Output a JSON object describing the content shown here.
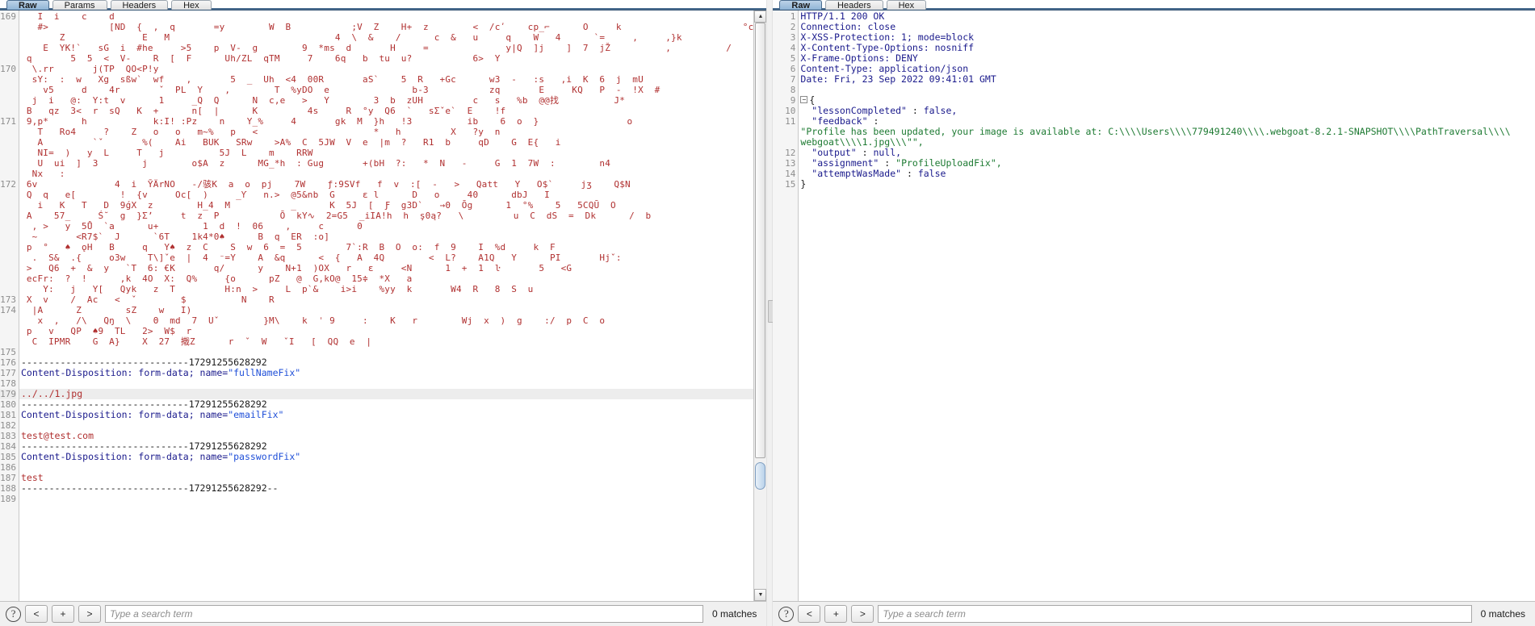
{
  "app": {
    "title": "Burp Suite — HTTP Request / Response viewer"
  },
  "left_panel": {
    "tabs": [
      {
        "label": "Raw",
        "active": true
      },
      {
        "label": "Params",
        "active": false
      },
      {
        "label": "Headers",
        "active": false
      },
      {
        "label": "Hex",
        "active": false
      }
    ],
    "first_line_number": 169,
    "last_line_number": 189,
    "highlighted_line": 179,
    "lines": [
      {
        "n": 169,
        "type": "bin",
        "text": "   I  i    c    d"
      },
      {
        "n": "",
        "type": "bin",
        "text": "   #>           [ND  {  ,  q       =y        W  B           ;V  Z    H+  z        <  /cʹ    cp_⌐      O     k                      °c"
      },
      {
        "n": "",
        "type": "bin",
        "text": "       Z              E   M                              4  \\  &    /      c  &   u     q    W   4      `=     ,     ,}k"
      },
      {
        "n": "",
        "type": "bin",
        "text": "    E  YK!`   sG  i  #he     >5    p  V-  g        9  *ms  d       H     =              y|Q  ]j    ]  7  jŽ          ,          /"
      },
      {
        "n": "",
        "type": "bin",
        "text": " q       5  5  <  V-    R  [  F      Uh/ZL  qTM     7    6q   b  tu  u?           6>  Y"
      },
      {
        "n": 170,
        "type": "bin",
        "text": "  \\.rr       j(TP  QO<P!y"
      },
      {
        "n": "",
        "type": "bin",
        "text": "  sY:  :  w   Xg  sßw`  wf    ,       5  _  Uh  <4  00R       aS`    5  R   +Gc      w3  -   :s   ,i  K  6  j  mU"
      },
      {
        "n": "",
        "type": "bin",
        "text": "    v5     d    4r       ˇ  PL  Y    ,        T  %yDO  e               b-3           zq       E     KQ   P  -  !X  #"
      },
      {
        "n": "",
        "type": "bin",
        "text": "  j  i   @:  Y:t  v      1     _Q  Q      N  c,e   >   Y        3  b  zUH         c   s   %b  @@找          J*"
      },
      {
        "n": "",
        "type": "bin",
        "text": " B   qz  3<  r  sQ   K  +      n[  |      K         4s     R  °y  Q6  `   sΣˇe`  E    !f"
      },
      {
        "n": 171,
        "type": "bin",
        "text": " 9,p*      h            k:I! :Pz    n    Y_%     4       gk  M  }h   !3          ib    6  o  }                o"
      },
      {
        "n": "",
        "type": "bin",
        "text": "   T   Ro4     ?    Z   o   o   m~%   p   <                     *   h         X   ?y  n"
      },
      {
        "n": "",
        "type": "bin",
        "text": "   A         `ˇ       %(    Ai   BUK   SRw    >A%  C  5JW  V  e  |m  ?   R1  b     qD    G  E{   i"
      },
      {
        "n": "",
        "type": "bin",
        "text": "   NI=  )   y  L     T   j          5J  L    m    RRW"
      },
      {
        "n": "",
        "type": "bin",
        "text": "   U  ui  ]  3        j        o$A  z      MG_*h  : Gug       +(bH  ?:   *  N   -     G  1  7W  :        n4"
      },
      {
        "n": "",
        "type": "bin",
        "text": "  Nx   :"
      },
      {
        "n": 172,
        "type": "bin",
        "text": " 6v              4  i  ȲÄrNO   -/骇K  a  o  pj    7W    ƒ:9SVf   f  v  :[  -   >   Qatt   Y   O$`     jʒ    Q$N"
      },
      {
        "n": "",
        "type": "bin",
        "text": " Q  q   e[        !  {v     Oc[  )     _Ƴ   n.>  @5&nb  G     ε l      D   o     40      dbJ   I"
      },
      {
        "n": "",
        "type": "bin",
        "text": "   i   K   T   D  9ǵX  z        H_4  M           _      K  5J  [  Ƒ  g3D`   →0  Ōg      1  °%    5   5CQŪ  O"
      },
      {
        "n": "",
        "type": "bin",
        "text": " A    57_     Ś˘  g  }Σʼ     t  z  P           Ō  kY∿  2=G5  _iIA!h  h  ş0ą?   \\         u  C  dS  =  Dk      /  b"
      },
      {
        "n": "",
        "type": "bin",
        "text": "  , >   y  5Ů  `a      u+        1  d  !  06    ,     c      0"
      },
      {
        "n": "",
        "type": "bin",
        "text": "  ~       <R7$`  J      `6T    1k4*0♠      B  q  ER  :o]"
      },
      {
        "n": "",
        "type": "bin",
        "text": " p  °   ♠  ǫH   B     q   Y♠  z  C    S  w  6  =  5        7`:R  B  O  o:  f  9    I  %d     k  F"
      },
      {
        "n": "",
        "type": "bin",
        "text": "  .  S&  .{     o3w    T\\]ˇe  |  4  ⁻=Y    A  &q      <  {   A  4Q        <  L?    A1Q   Y      PI       Hjˇ:"
      },
      {
        "n": "",
        "type": "bin",
        "text": " >   Q6  +  &  y   `T  6: €K       q/      y    N+1  )OX   r   ε     <N      1  +  1  ŀ       5   <G"
      },
      {
        "n": "",
        "type": "bin",
        "text": " ecFr:  ?  !      ,k  4O  X:  Q%     {o      pZ   @  G,kO@  15≑  *X   a"
      },
      {
        "n": "",
        "type": "bin",
        "text": "    Y:   j   Y[   Qyk   z  T         H:n  >     L  p`&    i>i    %yy  k       W4  R   8  S  u"
      },
      {
        "n": 173,
        "type": "bin",
        "text": " X  v    /  Ac   <  ˇ        $          N    R"
      },
      {
        "n": 174,
        "type": "bin",
        "text": "  |A      Z        sZ    w   I)"
      },
      {
        "n": "",
        "type": "bin",
        "text": "   x  ,   /\\   Qŋ  \\    Θ  md  7  Uˇ        }M\\    k  ˈ 9     :    K   r        Wj  x  )  g    :/  p  C  o"
      },
      {
        "n": "",
        "type": "bin",
        "text": " p   v   QP  ♠9  TL   2>  W$  r"
      },
      {
        "n": "",
        "type": "bin",
        "text": "  C  IPMR    G  A}    X  27  撠Z      r  ˇ  W   ˇI   [  QQ  e  |"
      },
      {
        "n": 175,
        "type": "bin",
        "text": ""
      },
      {
        "n": 176,
        "type": "boundary",
        "text": "------------------------------17291255628292"
      },
      {
        "n": 177,
        "type": "disposition",
        "prefix": "Content-Disposition: form-data; name=",
        "name": "\"fullNameFix\""
      },
      {
        "n": 178,
        "type": "blank",
        "text": ""
      },
      {
        "n": 179,
        "type": "value",
        "text": "../../1.jpg",
        "highlighted": true
      },
      {
        "n": 180,
        "type": "boundary",
        "text": "------------------------------17291255628292"
      },
      {
        "n": 181,
        "type": "disposition",
        "prefix": "Content-Disposition: form-data; name=",
        "name": "\"emailFix\""
      },
      {
        "n": 182,
        "type": "blank",
        "text": ""
      },
      {
        "n": 183,
        "type": "value",
        "text": "test@test.com"
      },
      {
        "n": 184,
        "type": "boundary",
        "text": "------------------------------17291255628292"
      },
      {
        "n": 185,
        "type": "disposition",
        "prefix": "Content-Disposition: form-data; name=",
        "name": "\"passwordFix\""
      },
      {
        "n": 186,
        "type": "blank",
        "text": ""
      },
      {
        "n": 187,
        "type": "value",
        "text": "test"
      },
      {
        "n": 188,
        "type": "boundary",
        "text": "------------------------------17291255628292--"
      },
      {
        "n": 189,
        "type": "blank",
        "text": ""
      }
    ],
    "search": {
      "help_label": "?",
      "prev_label": "<",
      "add_label": "+",
      "next_label": ">",
      "placeholder": "Type a search term",
      "value": "",
      "matches": "0 matches"
    }
  },
  "right_panel": {
    "tabs": [
      {
        "label": "Raw",
        "active": true
      },
      {
        "label": "Headers",
        "active": false
      },
      {
        "label": "Hex",
        "active": false
      }
    ],
    "lines": [
      {
        "n": 1,
        "type": "status",
        "text": "HTTP/1.1 200 OK"
      },
      {
        "n": 2,
        "type": "header",
        "key": "Connection",
        "value": "close"
      },
      {
        "n": 3,
        "type": "header",
        "key": "X-XSS-Protection",
        "value": "1; mode=block"
      },
      {
        "n": 4,
        "type": "header",
        "key": "X-Content-Type-Options",
        "value": "nosniff"
      },
      {
        "n": 5,
        "type": "header",
        "key": "X-Frame-Options",
        "value": "DENY"
      },
      {
        "n": 6,
        "type": "header",
        "key": "Content-Type",
        "value": "application/json"
      },
      {
        "n": 7,
        "type": "header",
        "key": "Date",
        "value": "Fri, 23 Sep 2022 09:41:01 GMT"
      },
      {
        "n": 8,
        "type": "blank",
        "text": ""
      },
      {
        "n": 9,
        "type": "brace-open",
        "fold": "−",
        "text": "{"
      },
      {
        "n": 10,
        "type": "json-pair",
        "key": "\"lessonCompleted\"",
        "sep": " : ",
        "lit": "false,"
      },
      {
        "n": 11,
        "type": "json-key-only",
        "key": "\"feedback\"",
        "sep": " :"
      },
      {
        "n": "",
        "type": "json-str-wrap",
        "text": "\"Profile has been updated, your image is available at: C:\\\\\\\\Users\\\\\\\\779491240\\\\\\\\.webgoat-8.2.1-SNAPSHOT\\\\\\\\PathTraversal\\\\\\\\"
      },
      {
        "n": "",
        "type": "json-str-wrap",
        "text": "webgoat\\\\\\\\1.jpg\\\\\\\"\","
      },
      {
        "n": 12,
        "type": "json-pair",
        "key": "\"output\"",
        "sep": " : ",
        "lit": "null,"
      },
      {
        "n": 13,
        "type": "json-pair-str",
        "key": "\"assignment\"",
        "sep": " : ",
        "str": "\"ProfileUploadFix\","
      },
      {
        "n": 14,
        "type": "json-pair",
        "key": "\"attemptWasMade\"",
        "sep": " : ",
        "lit": "false"
      },
      {
        "n": 15,
        "type": "brace-close",
        "text": "}"
      }
    ],
    "search": {
      "help_label": "?",
      "prev_label": "<",
      "add_label": "+",
      "next_label": ">",
      "placeholder": "Type a search term",
      "value": "",
      "matches": "0 matches"
    }
  },
  "colors": {
    "binary_red": "#b03030",
    "header_blue": "#1a1a8c",
    "json_string_green": "#1d7a32",
    "param_name_blue": "#1f4fd8",
    "tab_active": "#8fb4d6",
    "highlight_row": "#ededed"
  }
}
